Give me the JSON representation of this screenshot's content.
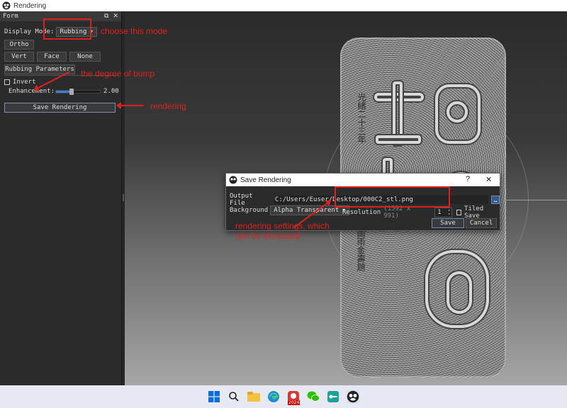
{
  "window": {
    "title": "Rendering"
  },
  "panel": {
    "title": "Form",
    "float_icon": "⧉",
    "close_icon": "✕",
    "display_mode_label": "Display Mode:",
    "display_mode_value": "Rubbing",
    "ortho_label": "Ortho",
    "vert_label": "Vert",
    "face_label": "Face",
    "none_label": "None",
    "rubbing_params_label": "Rubbing Parameters",
    "invert_label": "Invert",
    "enhancement_label": "Enhancement:",
    "enhancement_value": "2.00",
    "enhancement_fraction": 0.35,
    "save_rendering_label": "Save Rendering"
  },
  "annotations": {
    "choose_mode": "choose this mode",
    "bump": "the  degree of bump",
    "rendering": "rendering",
    "settings_line1": "rendering settings, which",
    "settings_line2": "can be increased"
  },
  "dialog": {
    "title": "Save Rendering",
    "help": "?",
    "close": "✕",
    "output_label": "Output File",
    "output_value": "C:/Users/Euser/Desktop/000C2_stl.png",
    "background_label": "Background",
    "background_value": "Alpha Transparent",
    "resolution_label": "Resolution",
    "resolution_value": "(1592 x 991)",
    "scale_value": "1",
    "tiled_save_label": "Tiled Save",
    "save_label": "Save",
    "cancel_label": "Cancel"
  },
  "stone_text": {
    "col1": "光緒二十三年",
    "col2": "圖雨金壽題"
  },
  "taskbar": {
    "qq_badge": "2024"
  }
}
